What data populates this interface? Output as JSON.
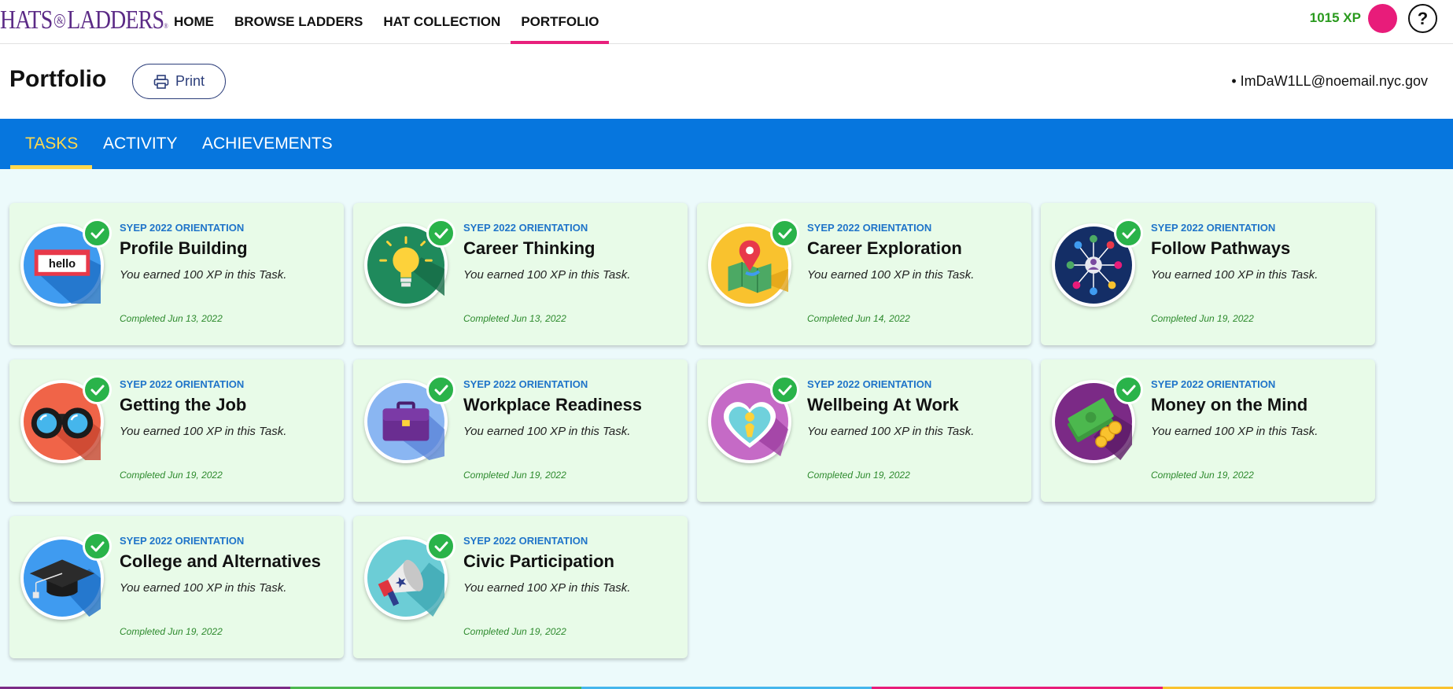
{
  "nav": {
    "logo_left": "HATS",
    "logo_amp": "&",
    "logo_right": "LADDERS",
    "logo_reg": "®",
    "links": [
      "HOME",
      "BROWSE LADDERS",
      "HAT COLLECTION",
      "PORTFOLIO"
    ],
    "active_link": "PORTFOLIO",
    "xp": "1015 XP",
    "help": "?"
  },
  "header": {
    "title": "Portfolio",
    "print_label": "Print",
    "email": "• ImDaW1LL@noemail.nyc.gov"
  },
  "tabs": [
    "TASKS",
    "ACTIVITY",
    "ACHIEVEMENTS"
  ],
  "active_tab": "TASKS",
  "colors": {
    "tab_bar": "#0676de",
    "tab_active": "#ffd84d",
    "nav_active": "#e8207c",
    "xp": "#2a9a1e",
    "card_bg": "#e8fbe8",
    "check": "#2ab34a"
  },
  "tasks": [
    {
      "category": "SYEP 2022 ORIENTATION",
      "title": "Profile Building",
      "earned": "You earned 100 XP in this Task.",
      "completed": "Completed Jun 13, 2022",
      "icon": "hello-name-tag-icon",
      "badge_text": "hello"
    },
    {
      "category": "SYEP 2022 ORIENTATION",
      "title": "Career Thinking",
      "earned": "You earned 100 XP in this Task.",
      "completed": "Completed Jun 13, 2022",
      "icon": "lightbulb-icon"
    },
    {
      "category": "SYEP 2022 ORIENTATION",
      "title": "Career Exploration",
      "earned": "You earned 100 XP in this Task.",
      "completed": "Completed Jun 14, 2022",
      "icon": "map-pin-icon"
    },
    {
      "category": "SYEP 2022 ORIENTATION",
      "title": "Follow Pathways",
      "earned": "You earned 100 XP in this Task.",
      "completed": "Completed Jun 19, 2022",
      "icon": "network-icon"
    },
    {
      "category": "SYEP 2022 ORIENTATION",
      "title": "Getting the Job",
      "earned": "You earned 100 XP in this Task.",
      "completed": "Completed Jun 19, 2022",
      "icon": "binoculars-icon"
    },
    {
      "category": "SYEP 2022 ORIENTATION",
      "title": "Workplace Readiness",
      "earned": "You earned 100 XP in this Task.",
      "completed": "Completed Jun 19, 2022",
      "icon": "briefcase-icon"
    },
    {
      "category": "SYEP 2022 ORIENTATION",
      "title": "Wellbeing At Work",
      "earned": "You earned 100 XP in this Task.",
      "completed": "Completed Jun 19, 2022",
      "icon": "heart-icon"
    },
    {
      "category": "SYEP 2022 ORIENTATION",
      "title": "Money on the Mind",
      "earned": "You earned 100 XP in this Task.",
      "completed": "Completed Jun 19, 2022",
      "icon": "money-icon"
    },
    {
      "category": "SYEP 2022 ORIENTATION",
      "title": "College and Alternatives",
      "earned": "You earned 100 XP in this Task.",
      "completed": "Completed Jun 19, 2022",
      "icon": "graduation-cap-icon"
    },
    {
      "category": "SYEP 2022 ORIENTATION",
      "title": "Civic Participation",
      "earned": "You earned 100 XP in this Task.",
      "completed": "Completed Jun 19, 2022",
      "icon": "megaphone-icon"
    }
  ]
}
